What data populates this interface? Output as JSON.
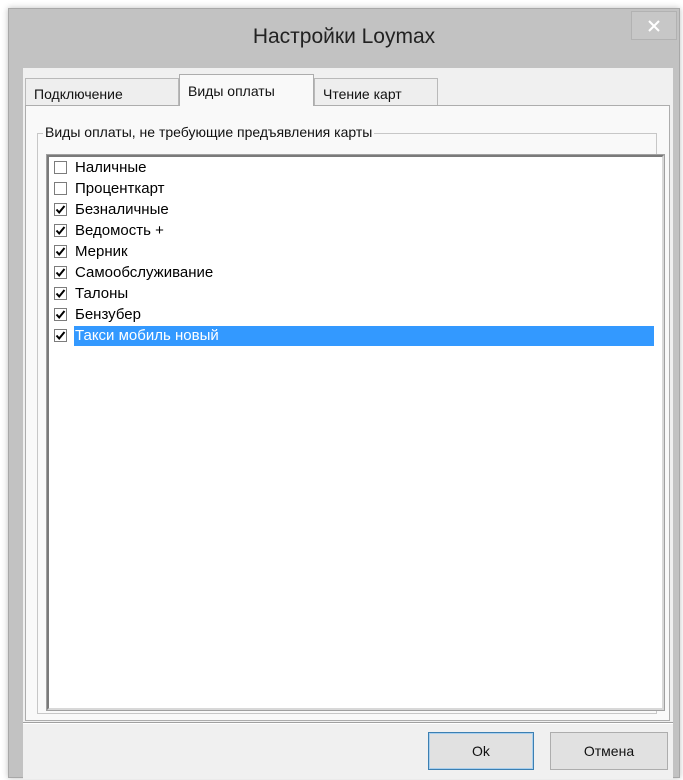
{
  "window": {
    "title": "Настройки Loymax"
  },
  "tabs": [
    {
      "label": "Подключение",
      "active": false
    },
    {
      "label": "Виды оплаты",
      "active": true
    },
    {
      "label": "Чтение карт",
      "active": false
    }
  ],
  "group": {
    "legend": "Виды оплаты, не требующие предъявления карты"
  },
  "items": [
    {
      "label": "Наличные",
      "checked": false,
      "selected": false
    },
    {
      "label": "Проценткарт",
      "checked": false,
      "selected": false
    },
    {
      "label": "Безналичные",
      "checked": true,
      "selected": false
    },
    {
      "label": "Ведомость +",
      "checked": true,
      "selected": false
    },
    {
      "label": "Мерник",
      "checked": true,
      "selected": false
    },
    {
      "label": "Самообслуживание",
      "checked": true,
      "selected": false
    },
    {
      "label": "Талоны",
      "checked": true,
      "selected": false
    },
    {
      "label": "Бензубер",
      "checked": true,
      "selected": false
    },
    {
      "label": "Такси мобиль новый",
      "checked": true,
      "selected": true
    }
  ],
  "buttons": {
    "ok": "Ok",
    "cancel": "Отмена"
  },
  "colors": {
    "selection": "#3399ff",
    "window_frame": "#c2c2c2",
    "dialog_bg": "#f0f0f0"
  },
  "icons": {
    "close": "close-icon",
    "check": "checkmark-icon"
  }
}
